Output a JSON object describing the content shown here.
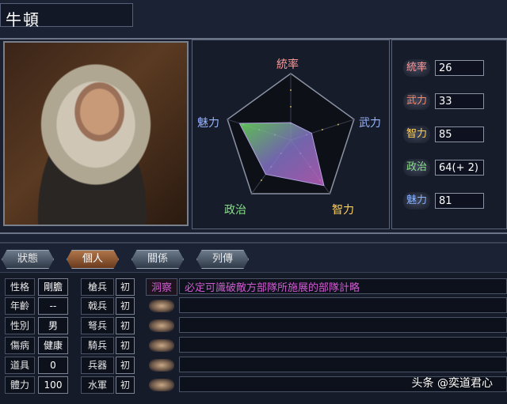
{
  "character": {
    "name": "牛頓"
  },
  "radar": {
    "labels": {
      "top": "統率",
      "right": "武力",
      "bottom_right": "智力",
      "bottom_left": "政治",
      "left": "魅力"
    },
    "values": {
      "tonglv": 26,
      "wuli": 33,
      "zhili": 85,
      "zhengzhi": 64,
      "meili": 81
    },
    "max": 100
  },
  "stats": [
    {
      "label": "統率",
      "value": "26",
      "color": "#ff8a8a"
    },
    {
      "label": "武力",
      "value": "33",
      "color": "#ff8a6a"
    },
    {
      "label": "智力",
      "value": "85",
      "color": "#ffd15a"
    },
    {
      "label": "政治",
      "value": "64(+ 2)",
      "color": "#8ae08a"
    },
    {
      "label": "魅力",
      "value": "81",
      "color": "#8ab4ff"
    }
  ],
  "tabs": [
    {
      "label": "狀態",
      "active": false
    },
    {
      "label": "個人",
      "active": true
    },
    {
      "label": "關係",
      "active": false
    },
    {
      "label": "列傳",
      "active": false
    }
  ],
  "profile": [
    {
      "label": "性格",
      "value": "剛膽"
    },
    {
      "label": "年齡",
      "value": "--"
    },
    {
      "label": "性別",
      "value": "男"
    },
    {
      "label": "傷病",
      "value": "健康"
    },
    {
      "label": "道具",
      "value": "0"
    },
    {
      "label": "體力",
      "value": "100"
    }
  ],
  "skills": [
    {
      "label": "槍兵",
      "value": "初"
    },
    {
      "label": "戟兵",
      "value": "初"
    },
    {
      "label": "弩兵",
      "value": "初"
    },
    {
      "label": "騎兵",
      "value": "初"
    },
    {
      "label": "兵器",
      "value": "初"
    },
    {
      "label": "水軍",
      "value": "初"
    }
  ],
  "traits": [
    {
      "name": "洞察",
      "desc": "必定可識破敵方部隊所施展的部隊計略"
    },
    {
      "name": "",
      "desc": ""
    },
    {
      "name": "",
      "desc": ""
    },
    {
      "name": "",
      "desc": ""
    },
    {
      "name": "",
      "desc": ""
    },
    {
      "name": "",
      "desc": ""
    }
  ],
  "watermark": "头条 @奕道君心"
}
